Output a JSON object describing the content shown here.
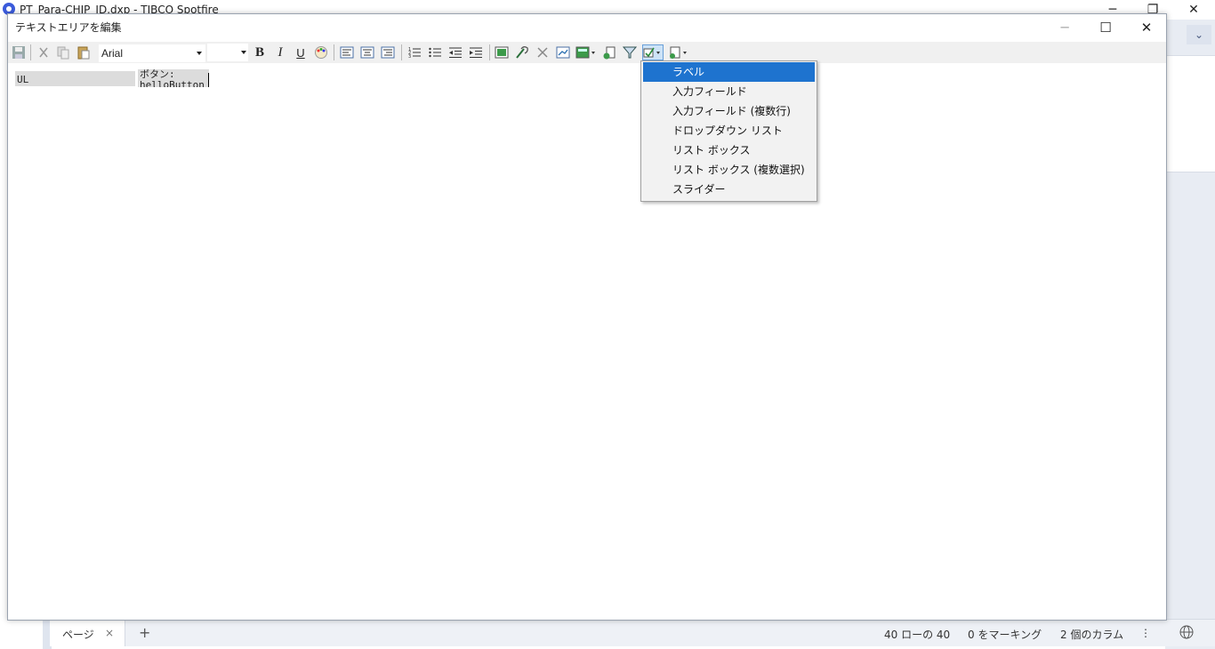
{
  "app": {
    "title": "PT_Para-CHIP_ID.dxp - TIBCO Spotfire",
    "minimize": "─",
    "restore": "❐",
    "close": "✕",
    "chevron": "⌄"
  },
  "dialog": {
    "title": "テキストエリアを編集",
    "minimize": "─",
    "maximize": "☐",
    "close": "✕"
  },
  "toolbar": {
    "font_name": "Arial",
    "bold": "B",
    "italic": "I",
    "underline": "U"
  },
  "editor": {
    "cell1": "UL",
    "cell2_line1": "ボタン:",
    "cell2_line2": "helloButton"
  },
  "menu": {
    "items": [
      {
        "label": "ラベル",
        "selected": true
      },
      {
        "label": "入力フィールド",
        "selected": false
      },
      {
        "label": "入力フィールド (複数行)",
        "selected": false
      },
      {
        "label": "ドロップダウン リスト",
        "selected": false
      },
      {
        "label": "リスト ボックス",
        "selected": false
      },
      {
        "label": "リスト ボックス (複数選択)",
        "selected": false
      },
      {
        "label": "スライダー",
        "selected": false
      }
    ]
  },
  "statusbar": {
    "tab_label": "ページ",
    "tab_close": "×",
    "add": "+",
    "rows": "40 ローの 40",
    "marking": "0 をマーキング",
    "columns": "2 個のカラム",
    "more": "⋮"
  },
  "colors": {
    "selection": "#1e73cf",
    "accent": "#3b5bdb"
  }
}
